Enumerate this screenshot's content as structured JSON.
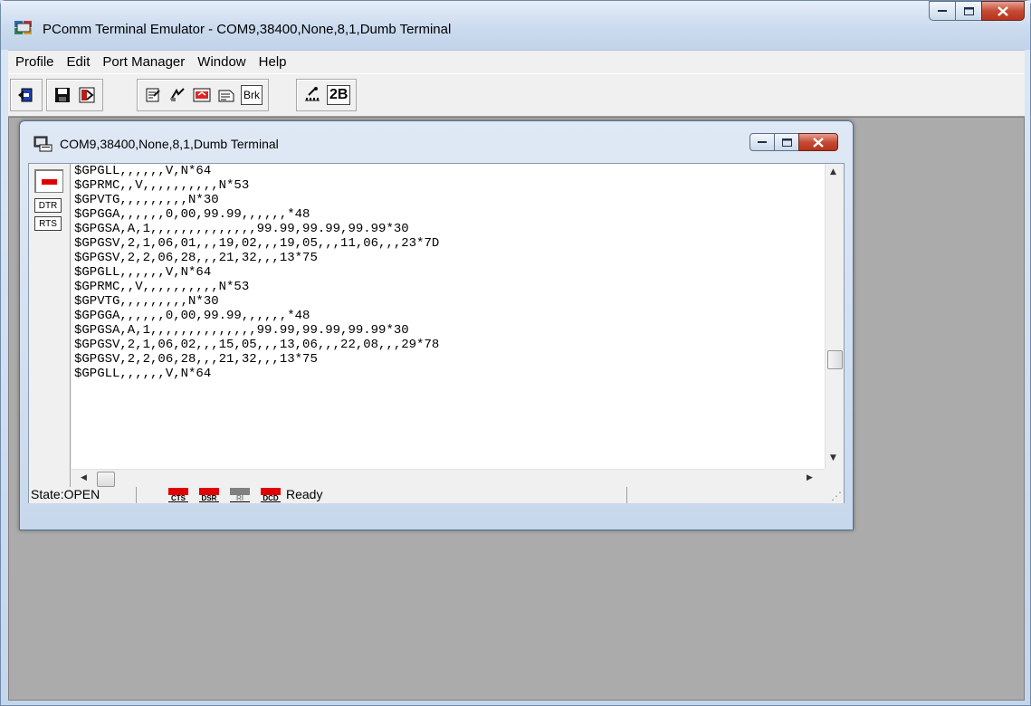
{
  "app": {
    "title": "PComm Terminal Emulator - COM9,38400,None,8,1,Dumb Terminal"
  },
  "menu": [
    "Profile",
    "Edit",
    "Port Manager",
    "Window",
    "Help"
  ],
  "toolbar": {
    "brk_label": "Brk",
    "twoB_label": "2B"
  },
  "child": {
    "title": "COM9,38400,None,8,1,Dumb Terminal",
    "signals": {
      "dtr": "DTR",
      "rts": "RTS"
    },
    "terminal_lines": [
      "$GPGLL,,,,,,V,N*64",
      "$GPRMC,,V,,,,,,,,,,N*53",
      "$GPVTG,,,,,,,,,N*30",
      "$GPGGA,,,,,,0,00,99.99,,,,,,*48",
      "$GPGSA,A,1,,,,,,,,,,,,,,99.99,99.99,99.99*30",
      "$GPGSV,2,1,06,01,,,19,02,,,19,05,,,11,06,,,23*7D",
      "$GPGSV,2,2,06,28,,,21,32,,,13*75",
      "$GPGLL,,,,,,V,N*64",
      "$GPRMC,,V,,,,,,,,,,N*53",
      "$GPVTG,,,,,,,,,N*30",
      "$GPGGA,,,,,,0,00,99.99,,,,,,*48",
      "$GPGSA,A,1,,,,,,,,,,,,,,99.99,99.99,99.99*30",
      "$GPGSV,2,1,06,02,,,15,05,,,13,06,,,22,08,,,29*78",
      "$GPGSV,2,2,06,28,,,21,32,,,13*75",
      "$GPGLL,,,,,,V,N*64"
    ],
    "status": {
      "state": "State:OPEN",
      "indicators": [
        {
          "label": "CTS",
          "on": true
        },
        {
          "label": "DSR",
          "on": true
        },
        {
          "label": "RI",
          "on": false
        },
        {
          "label": "DCD",
          "on": true
        }
      ],
      "message": "Ready"
    }
  },
  "colors": {
    "led_on": "#e00000",
    "led_off": "#808080",
    "mdi_background": "#ababab"
  }
}
